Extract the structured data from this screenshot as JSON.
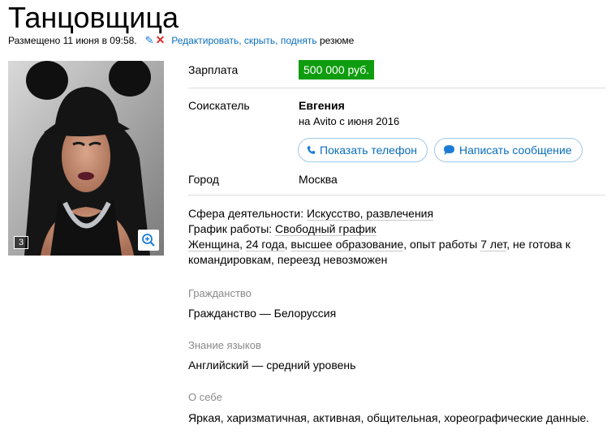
{
  "ad": {
    "title": "Танцовщица",
    "posted": "Размещено 11 июня в 09:58.",
    "actions_links": "Редактировать, скрыть, поднять",
    "actions_suffix": " резюме"
  },
  "icons": {
    "edit": "pencil-icon",
    "delete": "cross-icon",
    "zoom": "magnifier-plus-icon",
    "phone": "phone-icon",
    "message": "speech-bubble-icon"
  },
  "photo": {
    "count": "3"
  },
  "salary": {
    "label": "Зарплата",
    "value": "500 000 руб."
  },
  "applicant": {
    "label": "Соискатель",
    "name": "Евгения",
    "since": "на Avito с июня 2016",
    "show_phone": "Показать телефон",
    "write_message": "Написать сообщение"
  },
  "city": {
    "label": "Город",
    "value": "Москва"
  },
  "details": {
    "field_label": "Сфера деятельности: ",
    "field_value": "Искусство, развлечения",
    "schedule_label": "График работы: ",
    "schedule_value": "Свободный график",
    "gender": "Женщина",
    "sep1": ", ",
    "age": "24 года",
    "sep2": ", ",
    "education": "высшее образование",
    "exp_prefix": ", опыт работы ",
    "experience": "7 лет",
    "rest": ", не готова к командировкам, переезд невозможен"
  },
  "citizenship": {
    "title": "Гражданство",
    "value": "Гражданство — Белоруссия"
  },
  "languages": {
    "title": "Знание языков",
    "value": "Английский — средний уровень"
  },
  "about": {
    "title": "О себе",
    "value": "Яркая, харизматичная, активная, общительная, хореографические данные."
  },
  "colors": {
    "salary_bg": "#0f9d0f",
    "link": "#0a6ebd",
    "delete": "#e02a2a",
    "muted": "#8a8a8a"
  }
}
